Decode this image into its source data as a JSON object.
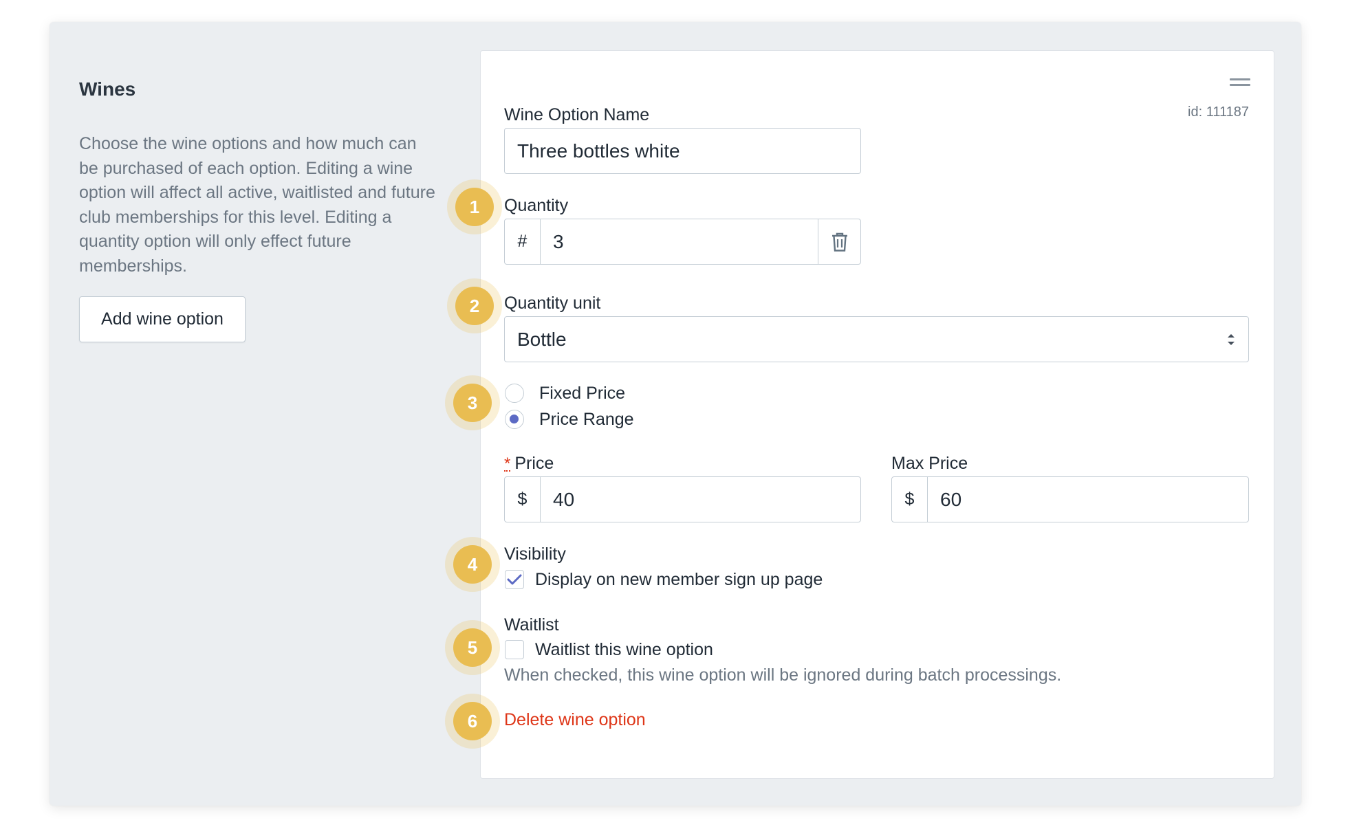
{
  "section": {
    "title": "Wines",
    "description": "Choose the wine options and how much can be purchased of each option. Editing a wine option will affect all active, waitlisted and future club memberships for this level. Editing a quantity option will only effect future memberships.",
    "add_button": "Add wine option"
  },
  "card": {
    "id_label": "id: 111187",
    "name_label": "Wine Option Name",
    "name_value": "Three bottles white",
    "quantity_label": "Quantity",
    "quantity_prefix": "#",
    "quantity_value": "3",
    "unit_label": "Quantity unit",
    "unit_value": "Bottle",
    "pricing": {
      "fixed_label": "Fixed Price",
      "range_label": "Price Range",
      "selected": "Price Range"
    },
    "price_required_mark": "*",
    "price_label": "Price",
    "price_prefix": "$",
    "price_value": "40",
    "max_price_label": "Max Price",
    "max_price_prefix": "$",
    "max_price_value": "60",
    "visibility_label": "Visibility",
    "visibility_option": "Display on new member sign up page",
    "visibility_checked": true,
    "waitlist_label": "Waitlist",
    "waitlist_option": "Waitlist this wine option",
    "waitlist_checked": false,
    "waitlist_help": "When checked, this wine option will be ignored during batch processings.",
    "delete_label": "Delete wine option"
  },
  "callouts": [
    "1",
    "2",
    "3",
    "4",
    "5",
    "6"
  ],
  "colors": {
    "accent": "#5c6ac4",
    "danger": "#de3618",
    "callout": "#e9bd52",
    "panel_bg": "#ebeef1"
  }
}
